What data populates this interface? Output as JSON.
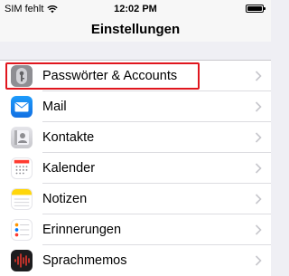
{
  "status": {
    "carrier": "SIM fehlt",
    "time": "12:02 PM",
    "battery_level": 1.0
  },
  "nav": {
    "title": "Einstellungen"
  },
  "settings": {
    "items": [
      {
        "label": "Passwörter & Accounts",
        "icon": "key-icon",
        "color": "#8e8e93",
        "highlighted": true
      },
      {
        "label": "Mail",
        "icon": "mail-icon",
        "color": "#1a8cf0"
      },
      {
        "label": "Kontakte",
        "icon": "contacts-icon",
        "color": "#c7c7cc"
      },
      {
        "label": "Kalender",
        "icon": "calendar-icon",
        "color": "#ffffff"
      },
      {
        "label": "Notizen",
        "icon": "notes-icon",
        "color": "#ffd60a"
      },
      {
        "label": "Erinnerungen",
        "icon": "reminders-icon",
        "color": "#ffffff"
      },
      {
        "label": "Sprachmemos",
        "icon": "voice-memos-icon",
        "color": "#1c1c1e"
      }
    ]
  },
  "colors": {
    "highlight": "#e0161e",
    "background": "#efeff4"
  }
}
